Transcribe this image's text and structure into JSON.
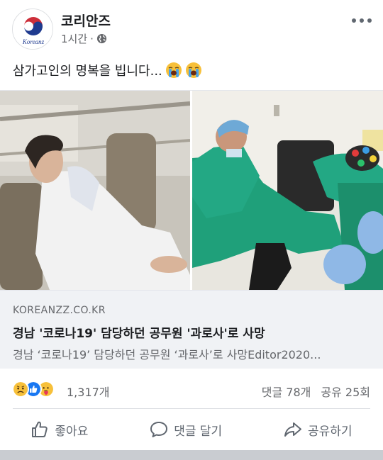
{
  "post": {
    "page_name": "코리안즈",
    "avatar_brand": "Koreanz",
    "time": "1시간",
    "separator": "·",
    "text": "삼가고인의 명복을 빕니다..."
  },
  "link_card": {
    "domain": "KOREANZZ.CO.KR",
    "title": "경남 '코로나19' 담당하던 공무원 '과로사'로 사망",
    "description": "경남 ‘코로나19’ 담당하던 공무원 ‘과로사’로 사망Editor2020..."
  },
  "stats": {
    "reaction_count": "1,317개",
    "comments": "댓글 78개",
    "shares": "공유 25회"
  },
  "actions": {
    "like": "좋아요",
    "comment": "댓글 달기",
    "share": "공유하기"
  },
  "colors": {
    "text_primary": "#1c1e21",
    "text_secondary": "#65676b",
    "like_blue": "#1877f2",
    "link_bg": "#f0f2f5"
  },
  "icons": {
    "more": "more-dots-icon",
    "privacy": "globe-icon",
    "like": "thumbs-up-icon",
    "comment": "speech-bubble-icon",
    "share": "share-arrow-icon"
  }
}
